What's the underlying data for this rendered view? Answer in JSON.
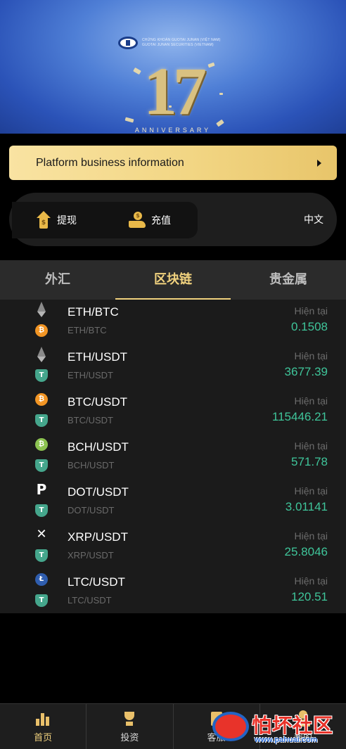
{
  "banner": {
    "brand_line1": "CHỨNG KHOÁN GUOTAI JUNAN (VIỆT NAM)",
    "brand_line2": "GUOTAI JUNAN SECURITIES (VIETNAM)",
    "anniversary_number": "17",
    "anniversary_text": "ANNIVERSARY"
  },
  "notice": {
    "text": "Platform business information",
    "arrow_icon": "caret-right-icon"
  },
  "actions": {
    "withdraw_label": "提现",
    "withdraw_icon": "withdraw-arrow-icon",
    "deposit_label": "充值",
    "deposit_icon": "deposit-hand-coin-icon",
    "language_label": "中文"
  },
  "tabs": [
    {
      "label": "外汇",
      "active": false
    },
    {
      "label": "区块链",
      "active": true
    },
    {
      "label": "贵金属",
      "active": false
    }
  ],
  "markets": [
    {
      "pair": "ETH/BTC",
      "sub": "ETH/BTC",
      "base": "eth",
      "quote": "btc",
      "label": "Hiện tại",
      "price": "0.1508"
    },
    {
      "pair": "ETH/USDT",
      "sub": "ETH/USDT",
      "base": "eth",
      "quote": "usdt",
      "label": "Hiện tại",
      "price": "3677.39"
    },
    {
      "pair": "BTC/USDT",
      "sub": "BTC/USDT",
      "base": "btc",
      "quote": "usdt",
      "label": "Hiện tại",
      "price": "115446.21"
    },
    {
      "pair": "BCH/USDT",
      "sub": "BCH/USDT",
      "base": "bch",
      "quote": "usdt",
      "label": "Hiện tại",
      "price": "571.78"
    },
    {
      "pair": "DOT/USDT",
      "sub": "DOT/USDT",
      "base": "dot",
      "quote": "usdt",
      "label": "Hiện tại",
      "price": "3.01141"
    },
    {
      "pair": "XRP/USDT",
      "sub": "XRP/USDT",
      "base": "xrp",
      "quote": "usdt",
      "label": "Hiện tại",
      "price": "25.8046"
    },
    {
      "pair": "LTC/USDT",
      "sub": "LTC/USDT",
      "base": "ltc",
      "quote": "usdt",
      "label": "Hiện tại",
      "price": "120.51"
    }
  ],
  "bottom_nav": [
    {
      "label": "首页",
      "icon": "bar-chart-icon",
      "active": true
    },
    {
      "label": "投资",
      "icon": "trophy-icon",
      "active": false
    },
    {
      "label": "客服",
      "icon": "document-icon",
      "active": false
    },
    {
      "label": "我的",
      "icon": "user-icon",
      "active": false
    }
  ],
  "watermark": {
    "title": "怕坏社区",
    "url": "www.pahuai.com"
  },
  "colors": {
    "accent_gold": "#f1d27e",
    "price_green": "#3fc59a",
    "background": "#1b1b1b"
  }
}
